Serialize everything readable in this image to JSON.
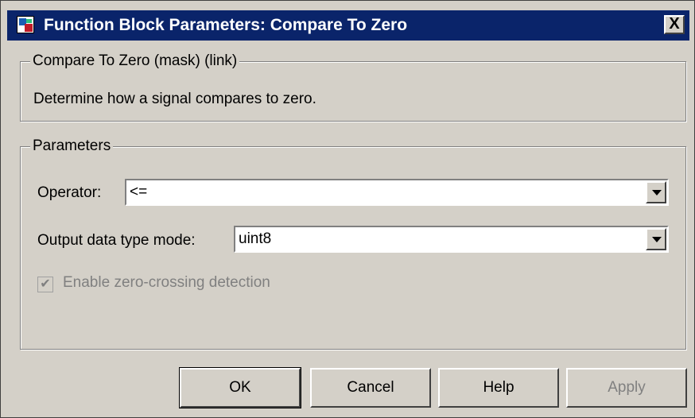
{
  "window": {
    "title": "Function Block Parameters: Compare To Zero",
    "close_label": "X",
    "icon": "simulink-block-icon"
  },
  "description_group": {
    "legend": "Compare To Zero (mask) (link)",
    "text": "Determine how a signal compares to zero."
  },
  "parameters_group": {
    "legend": "Parameters",
    "operator_label": "Operator:",
    "operator_value": "<=",
    "output_label": "Output data type mode:",
    "output_value": "uint8",
    "checkbox_label": "Enable zero-crossing detection",
    "checkbox_checked": true,
    "checkbox_mark": "✔",
    "checkbox_disabled": true
  },
  "buttons": {
    "ok": "OK",
    "cancel": "Cancel",
    "help": "Help",
    "apply": "Apply"
  },
  "colors": {
    "titlebar": "#0a246a",
    "dialog_bg": "#d4d0c8",
    "disabled_text": "#808080"
  }
}
